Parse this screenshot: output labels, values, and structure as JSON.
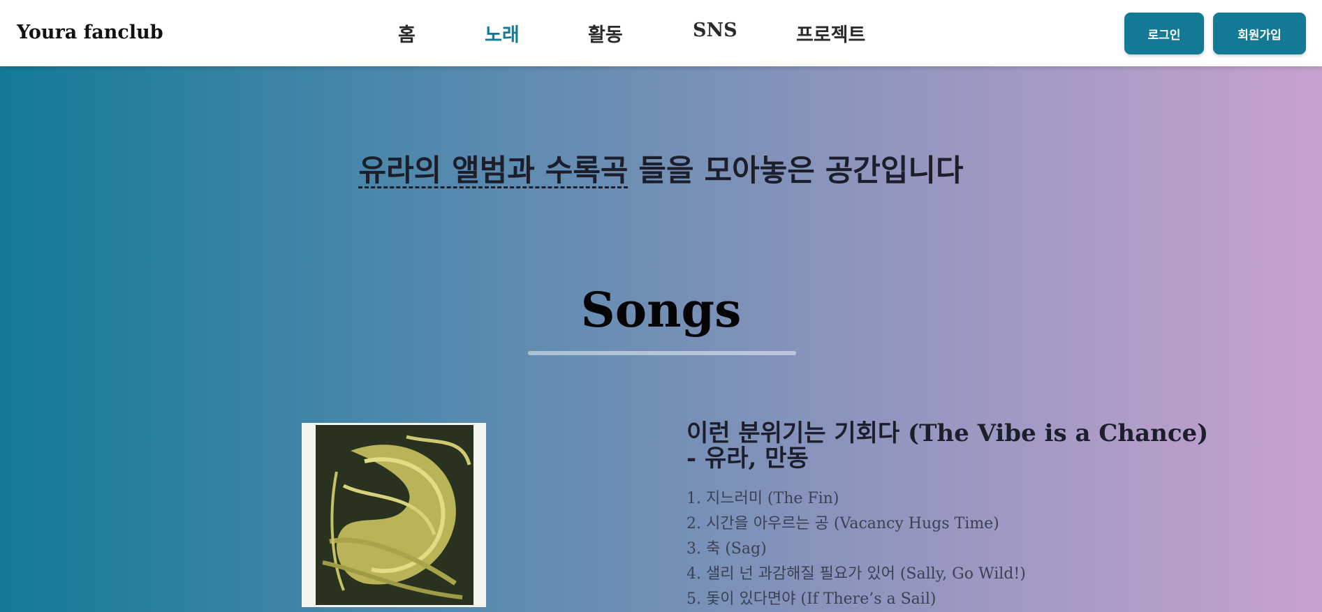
{
  "brand": "Youra fanclub",
  "nav": {
    "items": [
      {
        "label": "홈"
      },
      {
        "label": "노래"
      },
      {
        "label": "활동"
      },
      {
        "label": "SNS"
      },
      {
        "label": "프로젝트"
      }
    ],
    "active_index": 1,
    "active_color": "#137a96"
  },
  "auth": {
    "login_label": "로그인",
    "signup_label": "회원가입"
  },
  "intro": {
    "abbr_text": "유라의 앨범과 수록곡",
    "rest_text": " 들을 모아놓은 공간입니다"
  },
  "songs_title": "Songs",
  "album": {
    "title_line1": "이런 분위기는 기회다 (The Vibe is a Chance)",
    "title_line2": "- 유라, 만동",
    "cover_icon": "album-cover-artwork",
    "tracks": [
      "1. 지느러미 (The Fin)",
      "2. 시간을 아우르는 공 (Vacancy Hugs Time)",
      "3. 축 (Sag)",
      "4. 샐리 넌 과감해질 필요가 있어 (Sally, Go Wild!)",
      "5. 돛이 있다면야 (If There’s a Sail)"
    ]
  },
  "colors": {
    "brand_teal": "#137a96",
    "gradient_start": "#137a96",
    "gradient_end": "#c7a2cf"
  }
}
